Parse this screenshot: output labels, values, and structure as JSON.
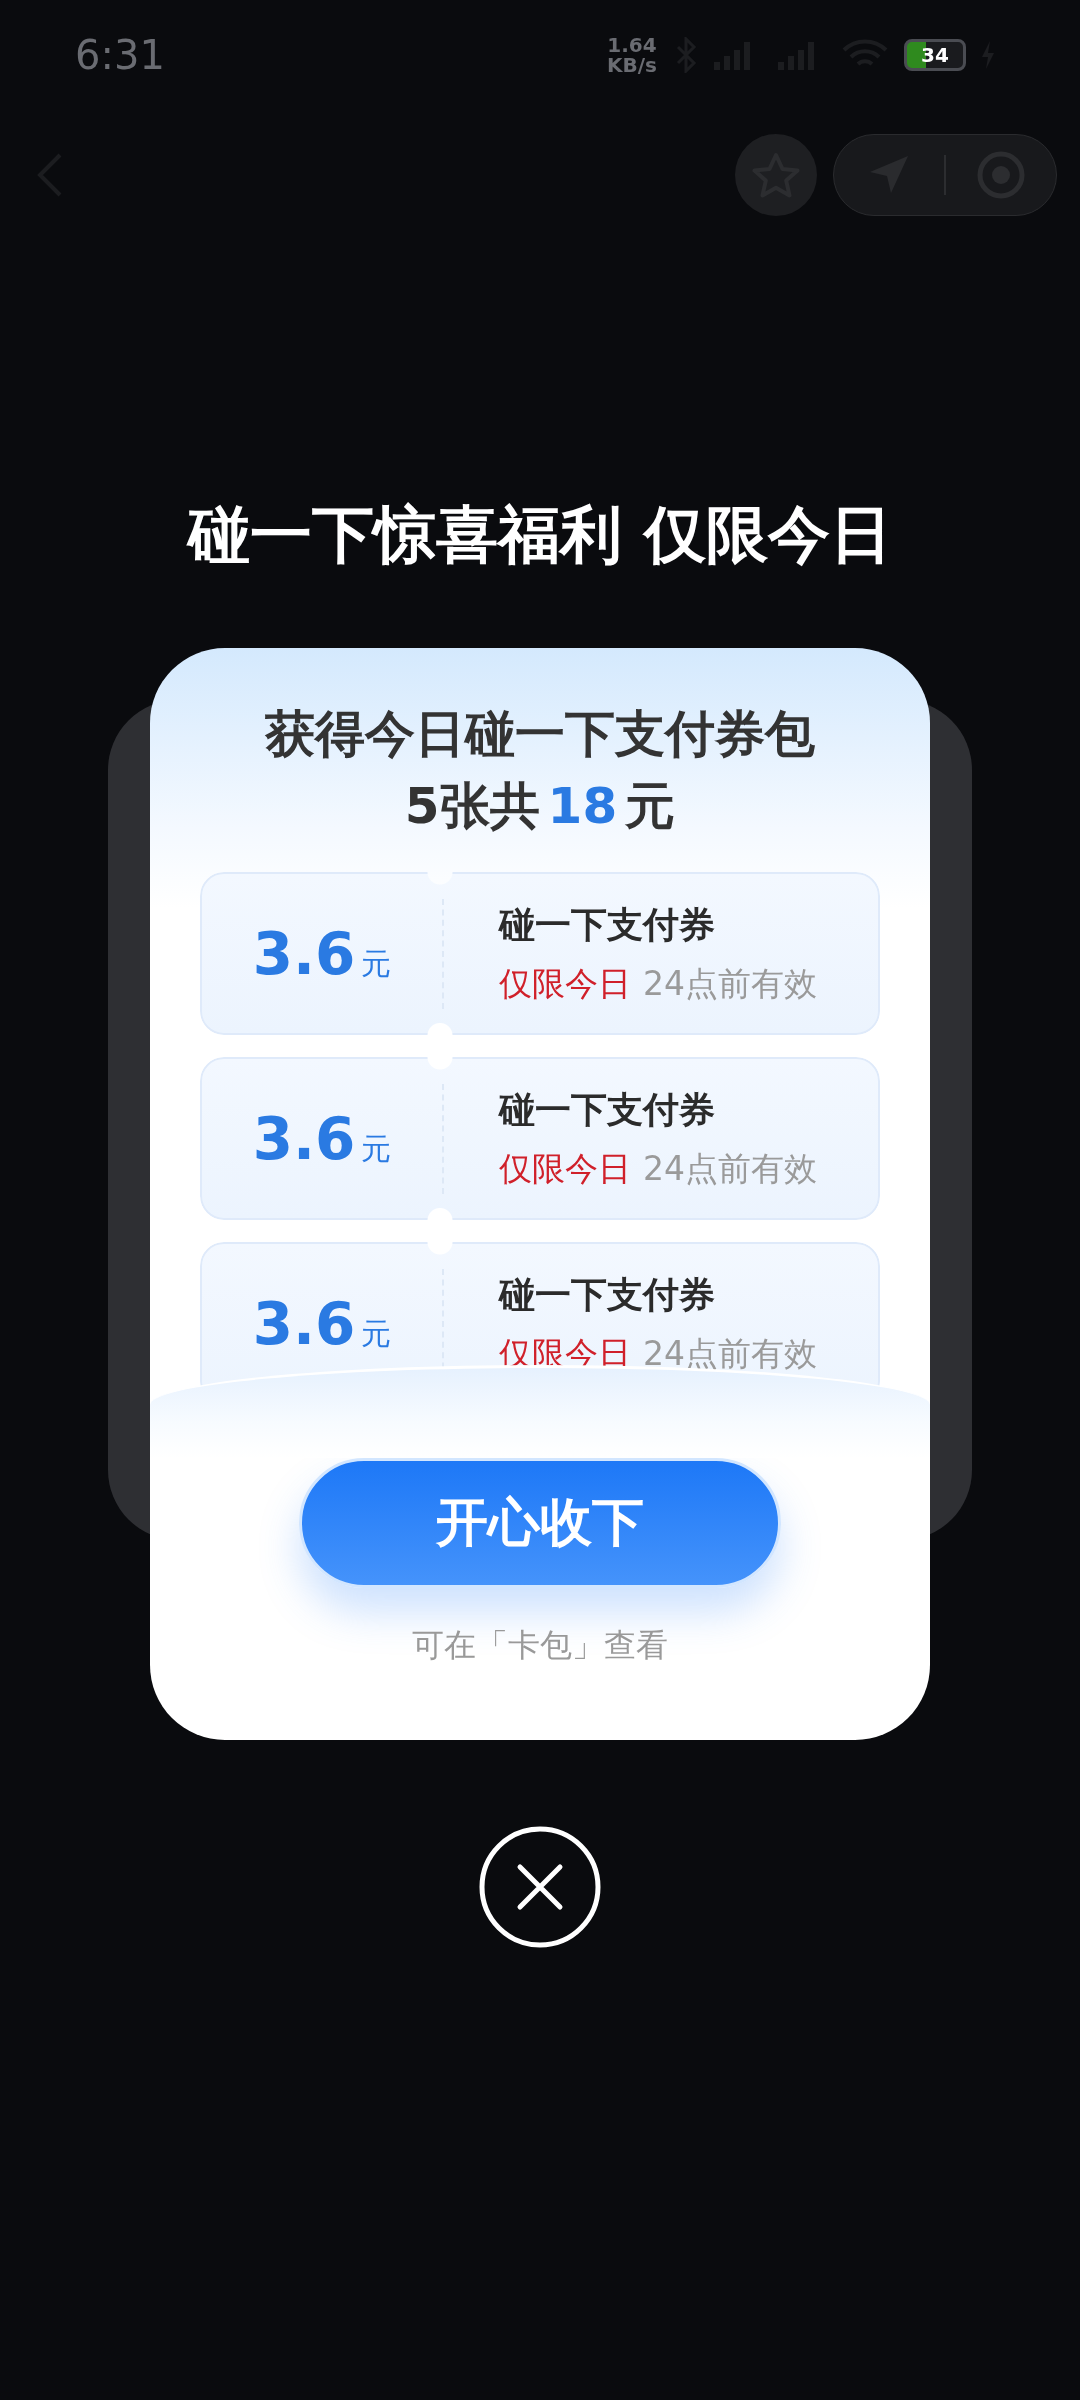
{
  "status_bar": {
    "time": "6:31",
    "net_speed": "1.64 KB/s",
    "battery": "34"
  },
  "promo_title": "碰一下惊喜福利 仅限今日",
  "modal": {
    "heading": "获得今日碰一下支付券包",
    "summary": {
      "prefix": "5张共",
      "amount": "18",
      "suffix": "元"
    },
    "coupons": [
      {
        "amount": "3.6",
        "unit": "元",
        "title": "碰一下支付券",
        "tag": "仅限今日",
        "validity": "24点前有效"
      },
      {
        "amount": "3.6",
        "unit": "元",
        "title": "碰一下支付券",
        "tag": "仅限今日",
        "validity": "24点前有效"
      },
      {
        "amount": "3.6",
        "unit": "元",
        "title": "碰一下支付券",
        "tag": "仅限今日",
        "validity": "24点前有效"
      }
    ],
    "accept_button": "开心收下",
    "hint": "可在「卡包」查看"
  }
}
